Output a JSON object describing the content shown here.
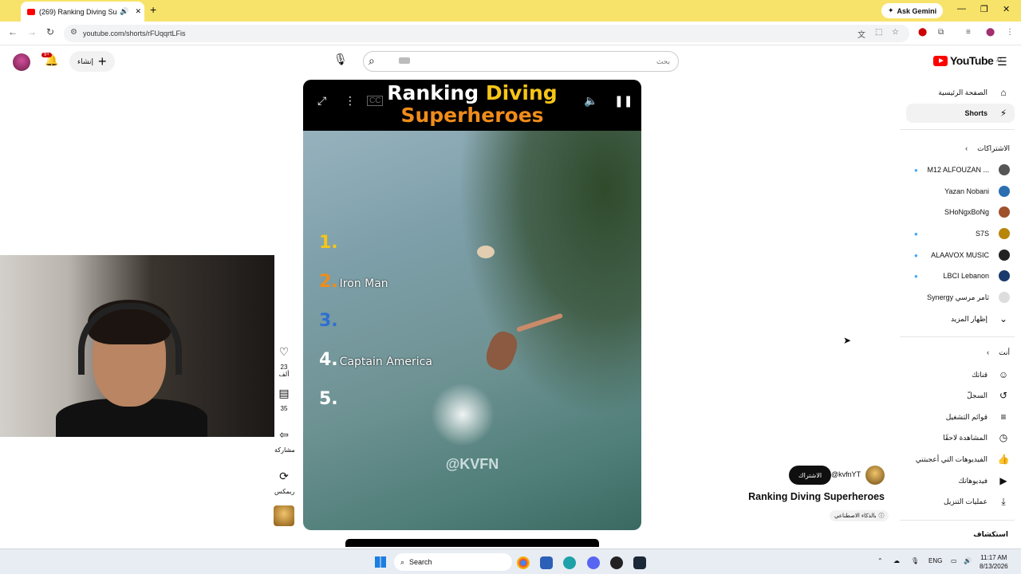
{
  "browser": {
    "tab_title": "(269) Ranking Diving Supe...",
    "new_tab": "+",
    "gemini_label": "Ask Gemini",
    "url": "youtube.com/shorts/rFUqqrtLFis"
  },
  "header": {
    "notif_count": "9+",
    "create_label": "إنشاء",
    "search_placeholder": "بحث",
    "logo_text": "YouTube",
    "logo_region": "JO"
  },
  "sidebar": {
    "home": "الصفحة الرئيسية",
    "shorts": "Shorts",
    "subs_heading": "الاشتراكات",
    "channels": [
      {
        "name": "M12 ALFOUZAN ...",
        "color": "#555"
      },
      {
        "name": "Yazan Nobani",
        "color": "#2c6fb0"
      },
      {
        "name": "SHoNgxBoNg",
        "color": "#a0522d"
      },
      {
        "name": "S7S",
        "color": "#b8860b"
      },
      {
        "name": "ALAAVOX MUSIC",
        "color": "#222"
      },
      {
        "name": "LBCI Lebanon",
        "color": "#1a3a6b"
      },
      {
        "name": "Synergy ثامر مرسي",
        "color": "#ddd"
      }
    ],
    "show_more": "إظهار المزيد",
    "you_heading": "أنت",
    "you_items": [
      {
        "label": "قناتك",
        "icon": "channel-icon"
      },
      {
        "label": "السجلّ",
        "icon": "history-icon"
      },
      {
        "label": "قوائم التشغيل",
        "icon": "playlists-icon"
      },
      {
        "label": "المشاهدة لاحقًا",
        "icon": "watch-later-icon"
      },
      {
        "label": "الفيديوهات التي أعجبتني",
        "icon": "liked-icon"
      },
      {
        "label": "فيديوهاتك",
        "icon": "your-videos-icon"
      },
      {
        "label": "عمليات التنزيل",
        "icon": "downloads-icon"
      }
    ],
    "explore_heading": "استكشاف"
  },
  "video": {
    "title_line1_a": "Ranking ",
    "title_line1_b": "Diving",
    "title_line2": "Superheroes",
    "ranks": [
      {
        "num": "1.",
        "name": "",
        "color": "#f5c518"
      },
      {
        "num": "2.",
        "name": "Iron Man",
        "color": "#f08c1a"
      },
      {
        "num": "3.",
        "name": "",
        "color": "#2f6fd0"
      },
      {
        "num": "4.",
        "name": "Captain America",
        "color": "#fff"
      },
      {
        "num": "5.",
        "name": "",
        "color": "#fff"
      }
    ],
    "watermark": "@KVFN"
  },
  "actions": {
    "likes": "23 ألف",
    "comments": "35",
    "share": "مشاركة",
    "remix": "ريمكس"
  },
  "channel": {
    "subscribe": "الاشتراك",
    "handle": "@kvfnYT",
    "video_title": "Ranking Diving Superheroes",
    "ai_label": "بالذكاء الاصطناعي"
  },
  "taskbar": {
    "search": "Search",
    "lang": "ENG",
    "time": "11:17 AM",
    "date": "8/13/2026"
  }
}
